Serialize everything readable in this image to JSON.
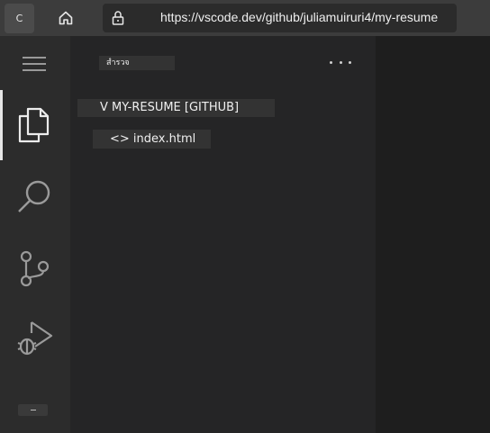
{
  "browser": {
    "back_label": "C",
    "home_icon": "home-icon",
    "lock_icon": "lock-icon",
    "url": "https://vscode.dev/github/juliamuiruri4/my-resume"
  },
  "activity_bar": {
    "menu_icon": "menu-icon",
    "items": [
      {
        "name": "explorer",
        "icon": "files-icon",
        "active": true
      },
      {
        "name": "search",
        "icon": "search-icon",
        "active": false
      },
      {
        "name": "source-control",
        "icon": "source-control-icon",
        "active": false
      },
      {
        "name": "run-and-debug",
        "icon": "run-debug-icon",
        "active": false
      }
    ]
  },
  "sidebar": {
    "title": "สำรวจ",
    "more_icon": "ellipsis-icon",
    "section": "V MY-RESUME [GITHUB]",
    "files": [
      {
        "label": "<> index.html"
      }
    ]
  },
  "colors": {
    "browser_bar": "#3c3c3c",
    "activity_bar": "#2c2c2c",
    "sidebar": "#252526",
    "editor": "#1e1e1e",
    "chip": "#333333",
    "icon": "#c5c5c5"
  }
}
